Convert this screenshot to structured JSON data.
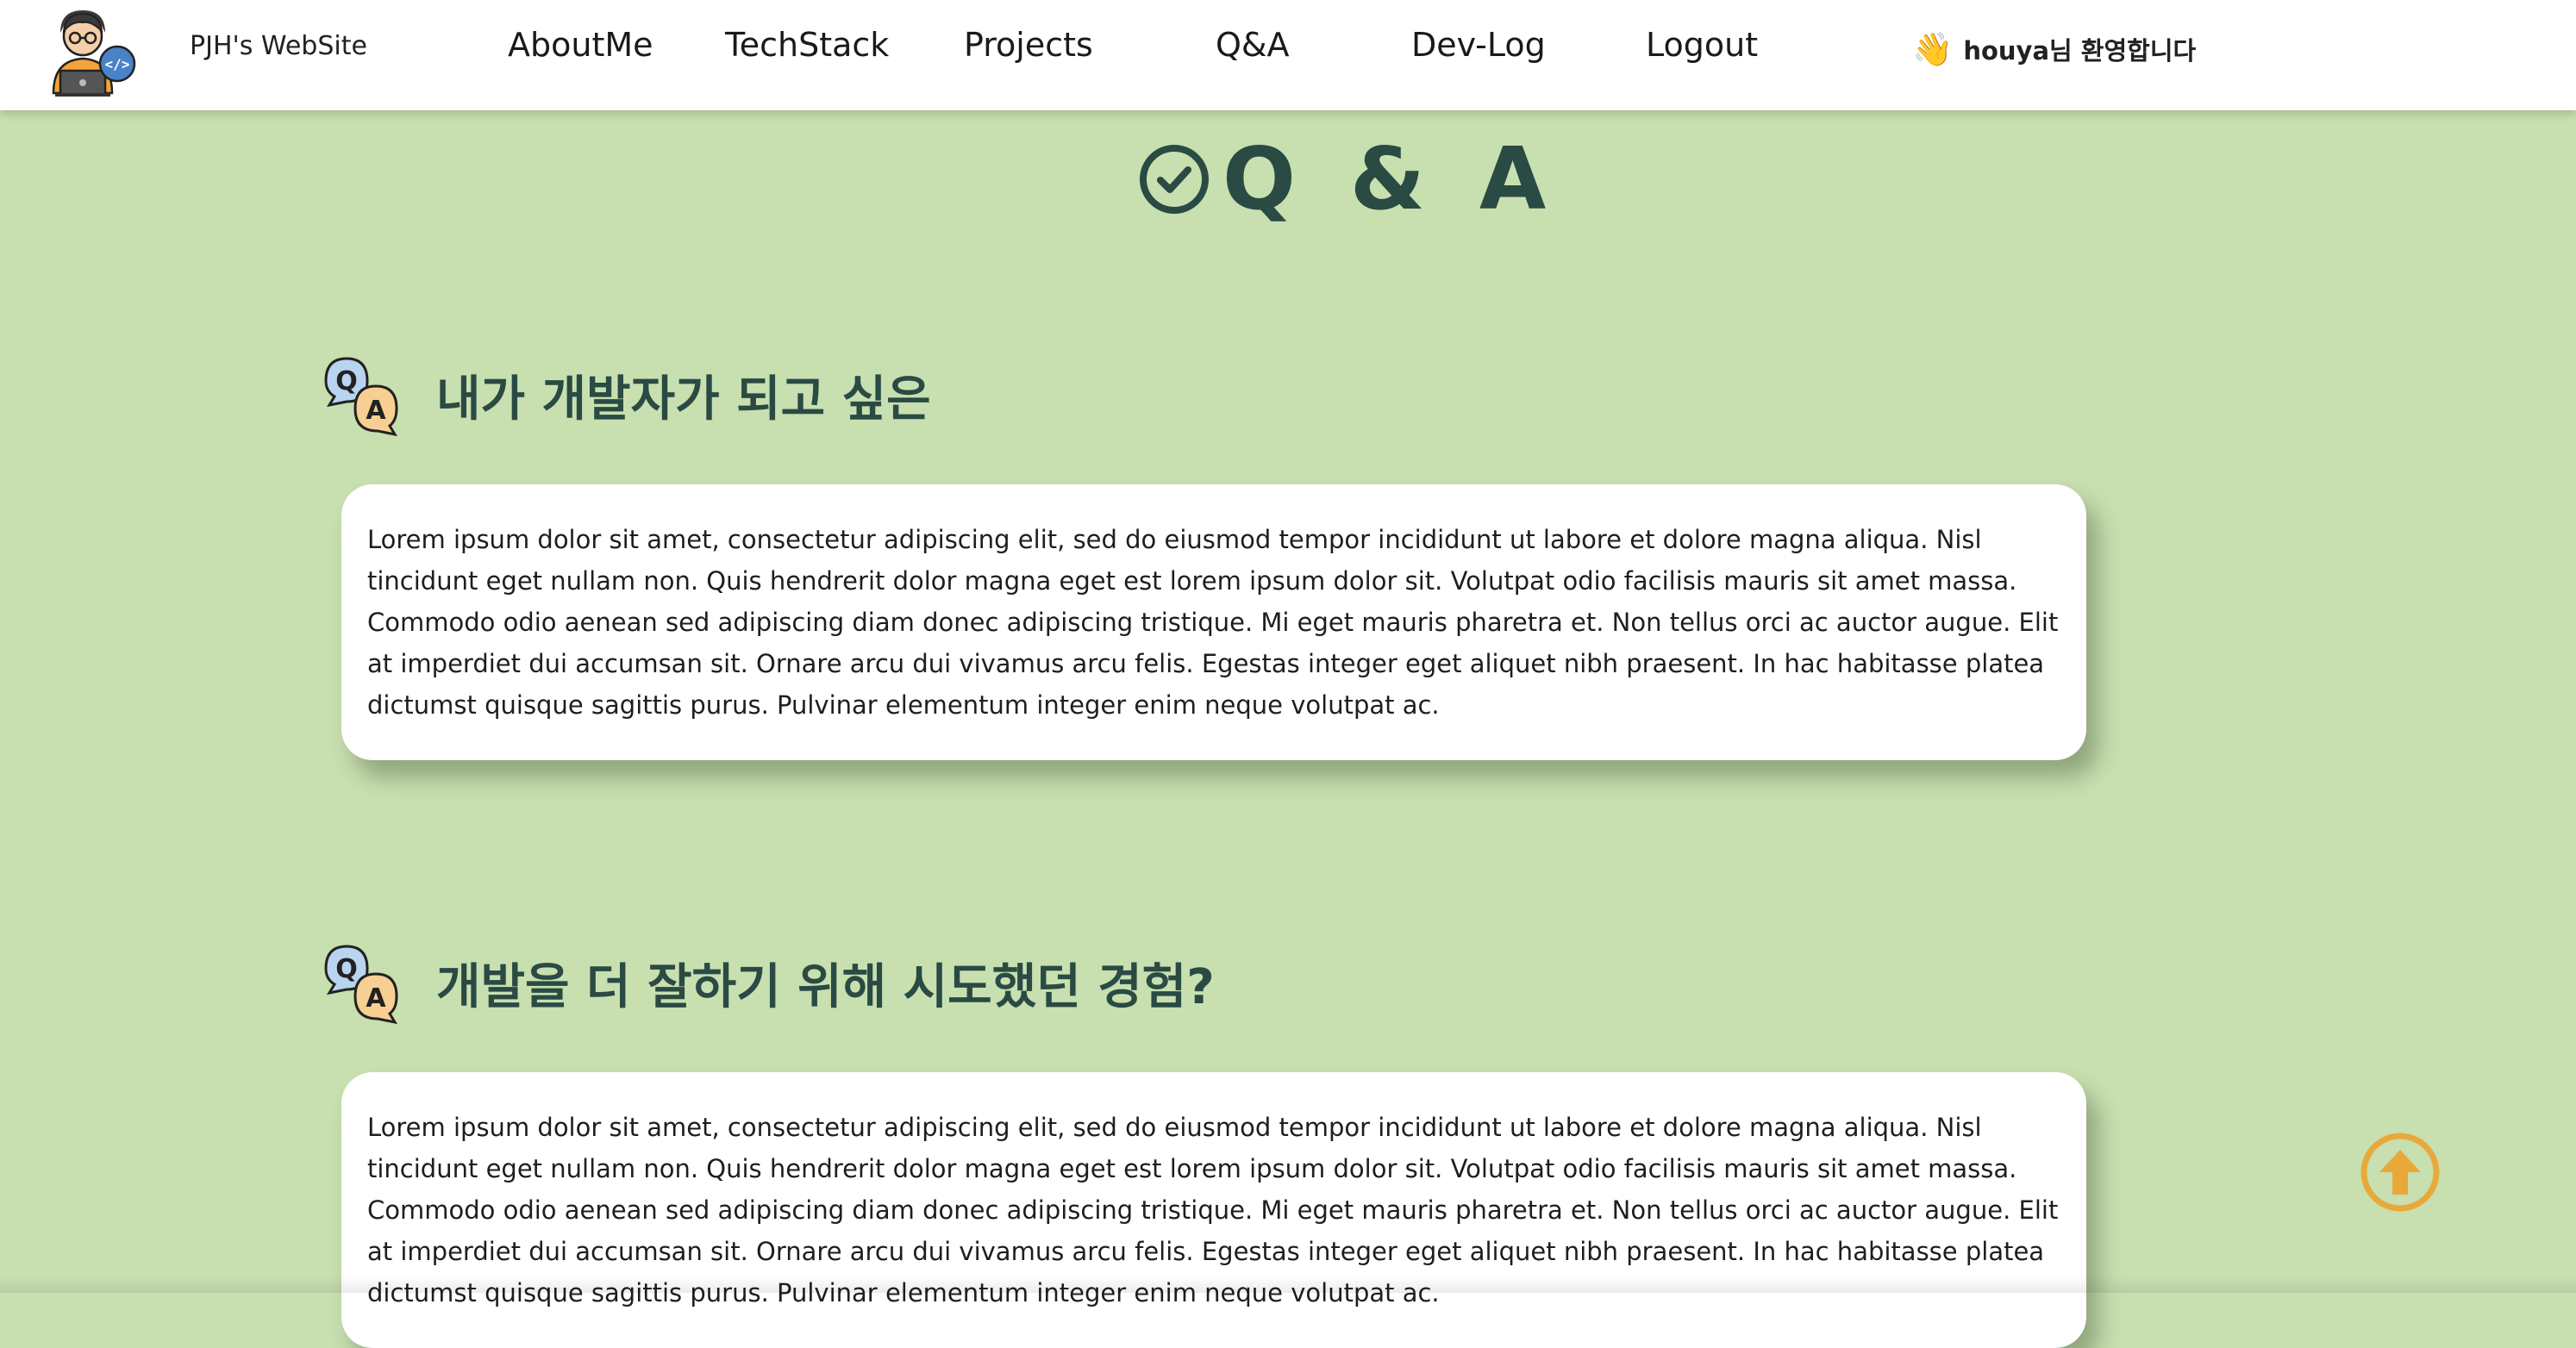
{
  "header": {
    "site_name": "PJH's WebSite",
    "nav": [
      {
        "label": "AboutMe"
      },
      {
        "label": "TechStack"
      },
      {
        "label": "Projects"
      },
      {
        "label": "Q&A"
      },
      {
        "label": "Dev-Log"
      },
      {
        "label": "Logout"
      }
    ],
    "welcome": {
      "emoji": "👋",
      "text": "houya님 환영합니다"
    }
  },
  "page": {
    "title": "Q & A"
  },
  "sections": [
    {
      "question": "내가 개발자가 되고 싶은",
      "answer": "Lorem ipsum dolor sit amet, consectetur adipiscing elit, sed do eiusmod tempor incididunt ut labore et dolore magna aliqua. Nisl tincidunt eget nullam non. Quis hendrerit dolor magna eget est lorem ipsum dolor sit. Volutpat odio facilisis mauris sit amet massa. Commodo odio aenean sed adipiscing diam donec adipiscing tristique. Mi eget mauris pharetra et. Non tellus orci ac auctor augue. Elit at imperdiet dui accumsan sit. Ornare arcu dui vivamus arcu felis. Egestas integer eget aliquet nibh praesent. In hac habitasse platea dictumst quisque sagittis purus. Pulvinar elementum integer enim neque volutpat ac."
    },
    {
      "question": "개발을 더 잘하기 위해 시도했던 경험?",
      "answer": "Lorem ipsum dolor sit amet, consectetur adipiscing elit, sed do eiusmod tempor incididunt ut labore et dolore magna aliqua. Nisl tincidunt eget nullam non. Quis hendrerit dolor magna eget est lorem ipsum dolor sit. Volutpat odio facilisis mauris sit amet massa. Commodo odio aenean sed adipiscing diam donec adipiscing tristique. Mi eget mauris pharetra et. Non tellus orci ac auctor augue. Elit at imperdiet dui accumsan sit. Ornare arcu dui vivamus arcu felis. Egestas integer eget aliquet nibh praesent. In hac habitasse platea dictumst quisque sagittis purus. Pulvinar elementum integer enim neque volutpat ac."
    }
  ],
  "icons": {
    "logo": "developer-avatar-icon",
    "title_icon": "check-circle-icon",
    "qa_icon": "qa-bubbles-icon",
    "scroll_top": "arrow-up-circle-icon"
  },
  "colors": {
    "background": "#c8dfb0",
    "heading": "#2a4a44",
    "scroll_top": "#e8a93a",
    "card": "#ffffff"
  }
}
